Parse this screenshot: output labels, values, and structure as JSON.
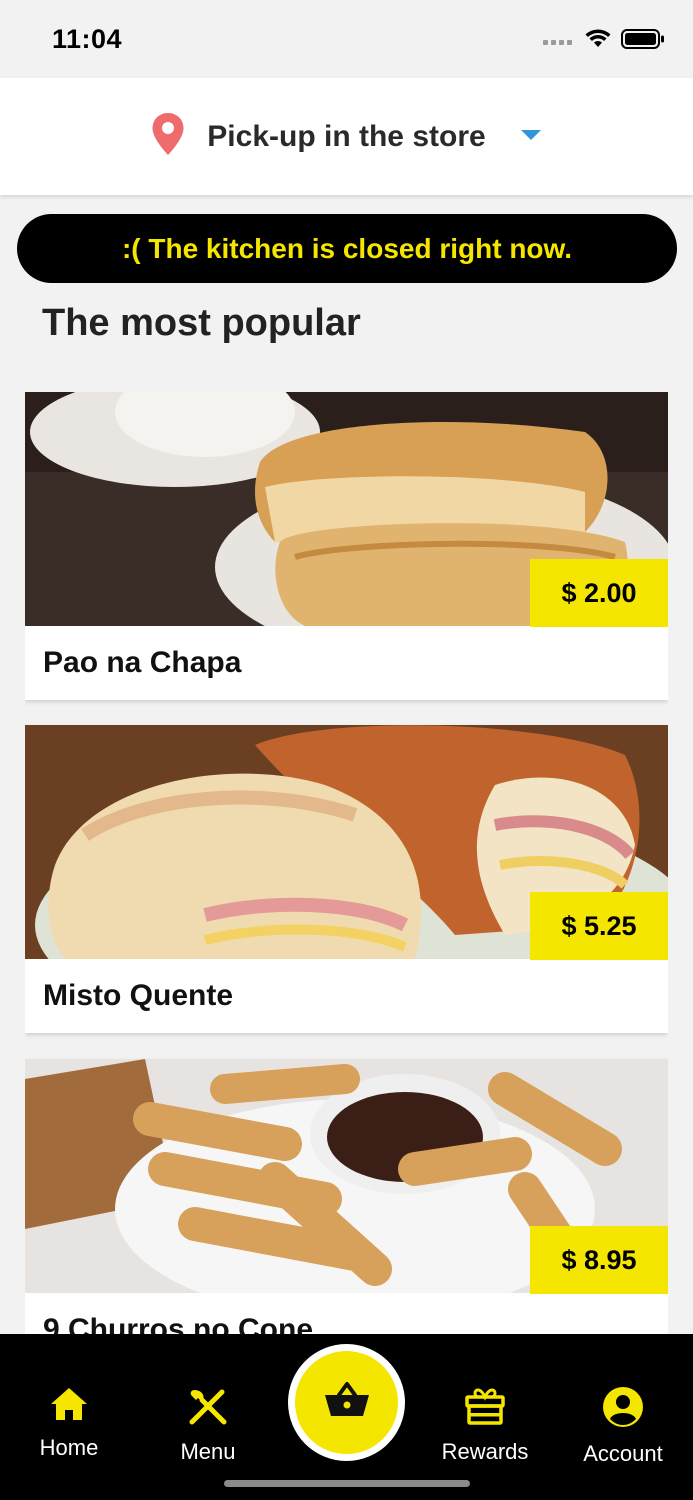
{
  "status_bar": {
    "time": "11:04"
  },
  "header": {
    "pickup_label": "Pick-up in the store"
  },
  "banner": {
    "text": ":( The kitchen is closed right now."
  },
  "section": {
    "title": "The most popular"
  },
  "products": [
    {
      "name": "Pao na Chapa",
      "price": "$ 2.00"
    },
    {
      "name": "Misto Quente",
      "price": "$ 5.25"
    },
    {
      "name": "9 Churros no Cone",
      "price": "$ 8.95"
    }
  ],
  "nav": {
    "home": "Home",
    "menu": "Menu",
    "rewards": "Rewards",
    "account": "Account"
  },
  "colors": {
    "accent": "#f5e600",
    "nav_background": "#000000",
    "pin": "#f06c6c",
    "dropdown": "#2f96d8"
  },
  "icons": {
    "status": [
      "signal-icon",
      "wifi-icon",
      "battery-icon"
    ],
    "header": [
      "location-pin-icon",
      "caret-down-icon"
    ],
    "nav": [
      "home-icon",
      "utensils-icon",
      "basket-icon",
      "gift-icon",
      "account-icon"
    ]
  }
}
